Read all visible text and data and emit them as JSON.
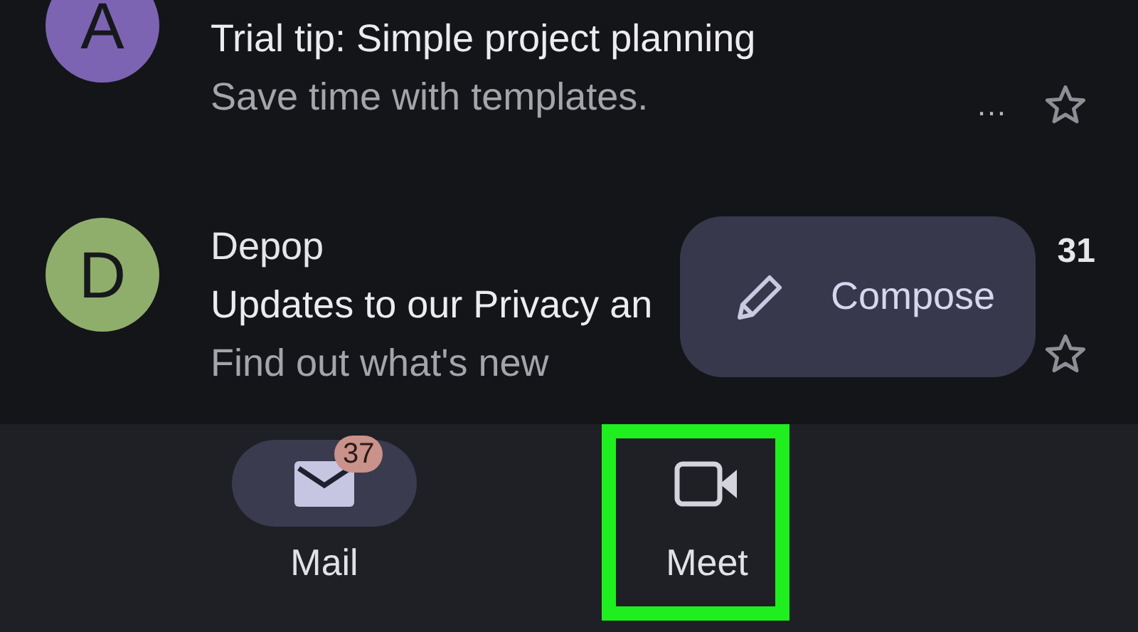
{
  "messages": [
    {
      "avatar_letter": "A",
      "color": "#7c64b2",
      "subject": "Trial tip: Simple project planning",
      "snippet": "Save time with templates.",
      "label": "…",
      "starred": false
    },
    {
      "avatar_letter": "D",
      "color": "#8fae6b",
      "sender": "Depop",
      "subject": "Updates to our Privacy an",
      "snippet": "Find out what's new",
      "time": "31",
      "starred": false
    }
  ],
  "compose": {
    "label": "Compose"
  },
  "bottom_nav": [
    {
      "kind": "mail",
      "label": "Mail",
      "badge": "37",
      "selected": true,
      "highlighted": false
    },
    {
      "kind": "meet",
      "label": "Meet",
      "selected": false,
      "highlighted": true
    }
  ]
}
